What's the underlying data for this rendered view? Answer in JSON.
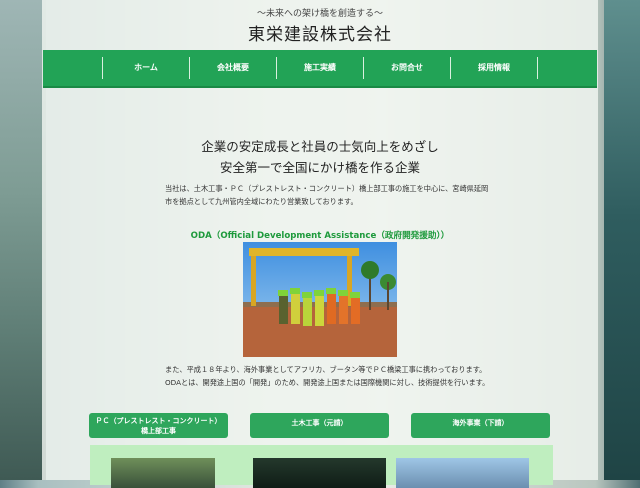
{
  "header": {
    "tagline": "〜未来への架け橋を創造する〜",
    "title": "東栄建設株式会社"
  },
  "nav": {
    "items": [
      {
        "label": "ホーム"
      },
      {
        "label": "会社概要"
      },
      {
        "label": "施工実績"
      },
      {
        "label": "お問合せ"
      },
      {
        "label": "採用情報"
      }
    ]
  },
  "main": {
    "headline_line1": "企業の安定成長と社員の士気向上をめざし",
    "headline_line2": "安全第一で全国にかけ橋を作る企業",
    "intro": "当社は、土木工事・ＰＣ（プレストレスト・コンクリート）橋上部工事の施工を中心に、宮崎県延岡市を拠点として九州管内全域にわたり営業致しております。",
    "oda_title": "ODA（Official Development Assistance（政府開発援助））",
    "para2": "また、平成１８年より、海外事業としてアフリカ、ブータン等でＰＣ橋梁工事に携わっております。ODAとは、開発途上国の「開発」のため、開発途上国または国際機関に対し、技術提供を行います。"
  },
  "buttons": {
    "pc_line1": "ＰＣ（プレストレスト・コンクリート）",
    "pc_line2": "橋上部工事",
    "civil": "土木工事（元請）",
    "overseas": "海外事業（下請）"
  },
  "colors": {
    "nav_green": "#22a356",
    "button_green": "#2ea65c",
    "oda_title_green": "#1e9a3c",
    "gallery_bg": "#bfeebf"
  }
}
